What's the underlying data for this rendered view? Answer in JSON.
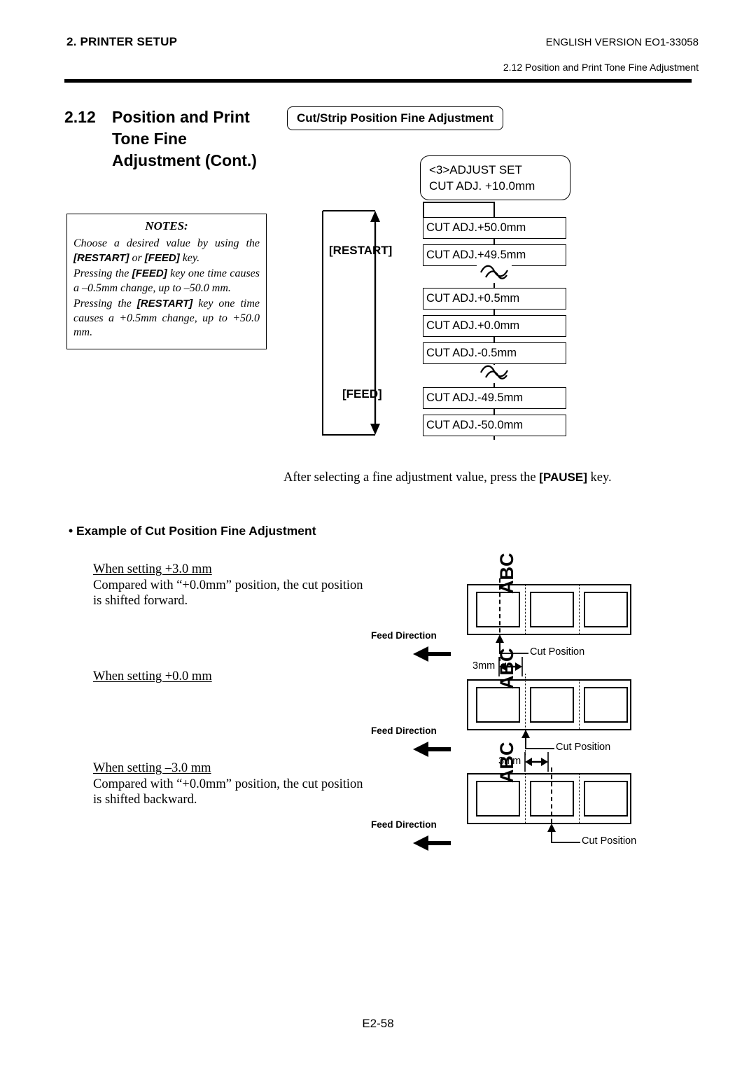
{
  "header": {
    "left": "2. PRINTER SETUP",
    "right": "ENGLISH VERSION EO1-33058",
    "sub": "2.12 Position and Print Tone Fine Adjustment"
  },
  "section": {
    "number": "2.12",
    "line1": "Position and Print",
    "line2": "Tone Fine",
    "line3": "Adjustment (Cont.)"
  },
  "notes": {
    "title": "NOTES:",
    "p1_a": "Choose a desired value by using the ",
    "p1_b": "[RESTART]",
    "p1_c": " or ",
    "p1_d": "[FEED]",
    "p1_e": " key.",
    "p2_a": "Pressing the ",
    "p2_b": "[FEED]",
    "p2_c": " key one time causes a –0.5mm change, up to –50.0 mm.",
    "p3_a": "Pressing the ",
    "p3_b": "[RESTART]",
    "p3_c": " key one time causes a +0.5mm change, up to +50.0 mm."
  },
  "flow": {
    "title": "Cut/Strip Position Fine Adjustment",
    "display_line1": "<3>ADJUST SET",
    "display_line2": "CUT ADJ. +10.0mm",
    "restart_label": "[RESTART]",
    "feed_label": "[FEED]",
    "values": [
      "CUT ADJ.+50.0mm",
      "CUT ADJ.+49.5mm",
      "CUT ADJ.+0.5mm",
      "CUT ADJ.+0.0mm",
      "CUT ADJ.-0.5mm",
      "CUT ADJ.-49.5mm",
      "CUT ADJ.-50.0mm"
    ]
  },
  "pause_note": {
    "before": "After selecting a fine adjustment value, press the ",
    "key": "[PAUSE]",
    "after": " key."
  },
  "example": {
    "heading": "• Example of Cut Position Fine Adjustment",
    "cases": [
      {
        "title": "When setting +3.0 mm",
        "body1": "Compared with “+0.0mm” position, the cut position",
        "body2": "is shifted forward."
      },
      {
        "title": "When setting +0.0 mm",
        "body1": "",
        "body2": ""
      },
      {
        "title": "When setting –3.0 mm",
        "body1": "Compared with “+0.0mm” position, the cut position",
        "body2": "is shifted backward."
      }
    ]
  },
  "diagrams": [
    {
      "feed_label": "Feed Direction",
      "cut_label": "Cut Position",
      "dim_label": "3mm",
      "label_text": "ABC"
    },
    {
      "feed_label": "Feed Direction",
      "cut_label": "Cut Position",
      "dim_label": "3mm",
      "label_text": "ABC"
    },
    {
      "feed_label": "Feed Direction",
      "cut_label": "Cut Position",
      "dim_label": "",
      "label_text": "ABC"
    }
  ],
  "footer": {
    "page": "E2-58"
  },
  "colors": {
    "ink": "#000000",
    "paper": "#ffffff"
  }
}
